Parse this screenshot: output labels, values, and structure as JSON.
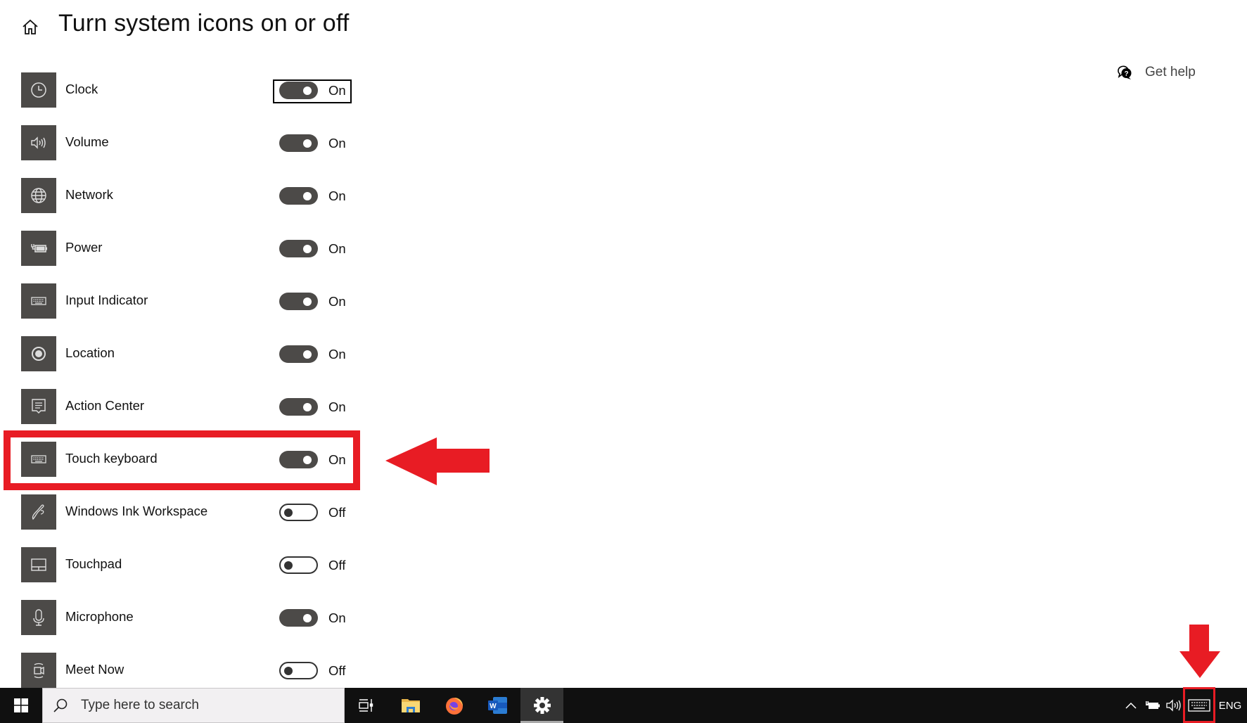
{
  "header": {
    "title": "Turn system icons on or off",
    "home_icon": "home-icon"
  },
  "help": {
    "label": "Get help",
    "icon": "help-chat-icon"
  },
  "settings": [
    {
      "label": "Clock",
      "icon": "clock-icon",
      "state": "On",
      "on": true,
      "focused": true
    },
    {
      "label": "Volume",
      "icon": "volume-icon",
      "state": "On",
      "on": true
    },
    {
      "label": "Network",
      "icon": "globe-icon",
      "state": "On",
      "on": true
    },
    {
      "label": "Power",
      "icon": "battery-plug-icon",
      "state": "On",
      "on": true
    },
    {
      "label": "Input Indicator",
      "icon": "keyboard-icon",
      "state": "On",
      "on": true
    },
    {
      "label": "Location",
      "icon": "location-icon",
      "state": "On",
      "on": true
    },
    {
      "label": "Action Center",
      "icon": "action-center-icon",
      "state": "On",
      "on": true
    },
    {
      "label": "Touch keyboard",
      "icon": "keyboard-icon",
      "state": "On",
      "on": true,
      "highlighted": true
    },
    {
      "label": "Windows Ink Workspace",
      "icon": "pen-icon",
      "state": "Off",
      "on": false
    },
    {
      "label": "Touchpad",
      "icon": "touchpad-icon",
      "state": "Off",
      "on": false
    },
    {
      "label": "Microphone",
      "icon": "microphone-icon",
      "state": "On",
      "on": true
    },
    {
      "label": "Meet Now",
      "icon": "meet-now-icon",
      "state": "Off",
      "on": false
    }
  ],
  "annotations": {
    "highlight_color": "#e81c24",
    "left_arrow_target": "Touch keyboard",
    "down_arrow_target": "touch-keyboard-tray-icon"
  },
  "taskbar": {
    "search_placeholder": "Type here to search",
    "apps": [
      {
        "name": "Task View",
        "icon": "task-view-icon"
      },
      {
        "name": "File Explorer",
        "icon": "folder-icon"
      },
      {
        "name": "Firefox",
        "icon": "firefox-icon"
      },
      {
        "name": "Word",
        "icon": "word-icon"
      },
      {
        "name": "Settings",
        "icon": "gear-icon",
        "active": true
      }
    ],
    "tray": {
      "language": "ENG"
    }
  },
  "colors": {
    "icon_tile": "#4c4a48",
    "taskbar": "#101010",
    "accent_red": "#e81c24"
  }
}
